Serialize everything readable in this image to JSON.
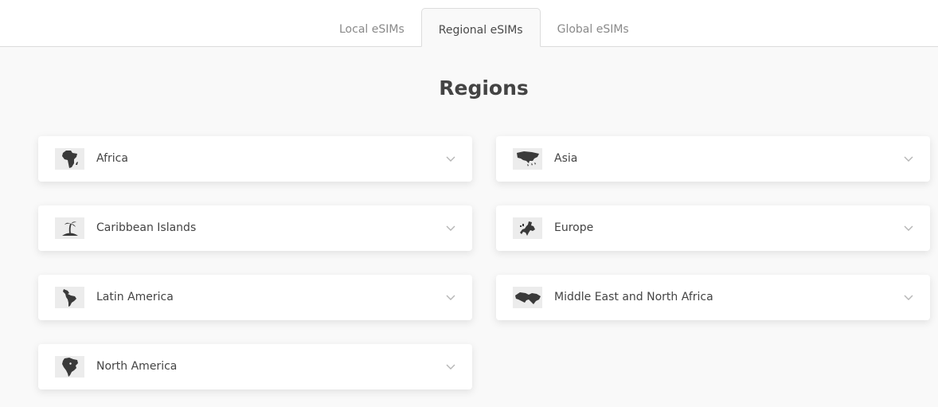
{
  "tabs": [
    {
      "label": "Local eSIMs",
      "active": false
    },
    {
      "label": "Regional eSIMs",
      "active": true
    },
    {
      "label": "Global eSIMs",
      "active": false
    }
  ],
  "page_title": "Regions",
  "regions": [
    {
      "label": "Africa",
      "icon": "africa-map-icon"
    },
    {
      "label": "Asia",
      "icon": "asia-map-icon"
    },
    {
      "label": "Caribbean Islands",
      "icon": "palm-island-icon"
    },
    {
      "label": "Europe",
      "icon": "europe-map-icon"
    },
    {
      "label": "Latin America",
      "icon": "latin-america-map-icon"
    },
    {
      "label": "Middle East and North Africa",
      "icon": "mena-map-icon"
    },
    {
      "label": "North America",
      "icon": "north-america-map-icon"
    }
  ],
  "colors": {
    "background": "#f9f9f9",
    "card": "#ffffff",
    "text": "#444444",
    "muted_text": "#8a8a8a",
    "icon_fill": "#3a3a3a",
    "icon_bg": "#ececec"
  }
}
